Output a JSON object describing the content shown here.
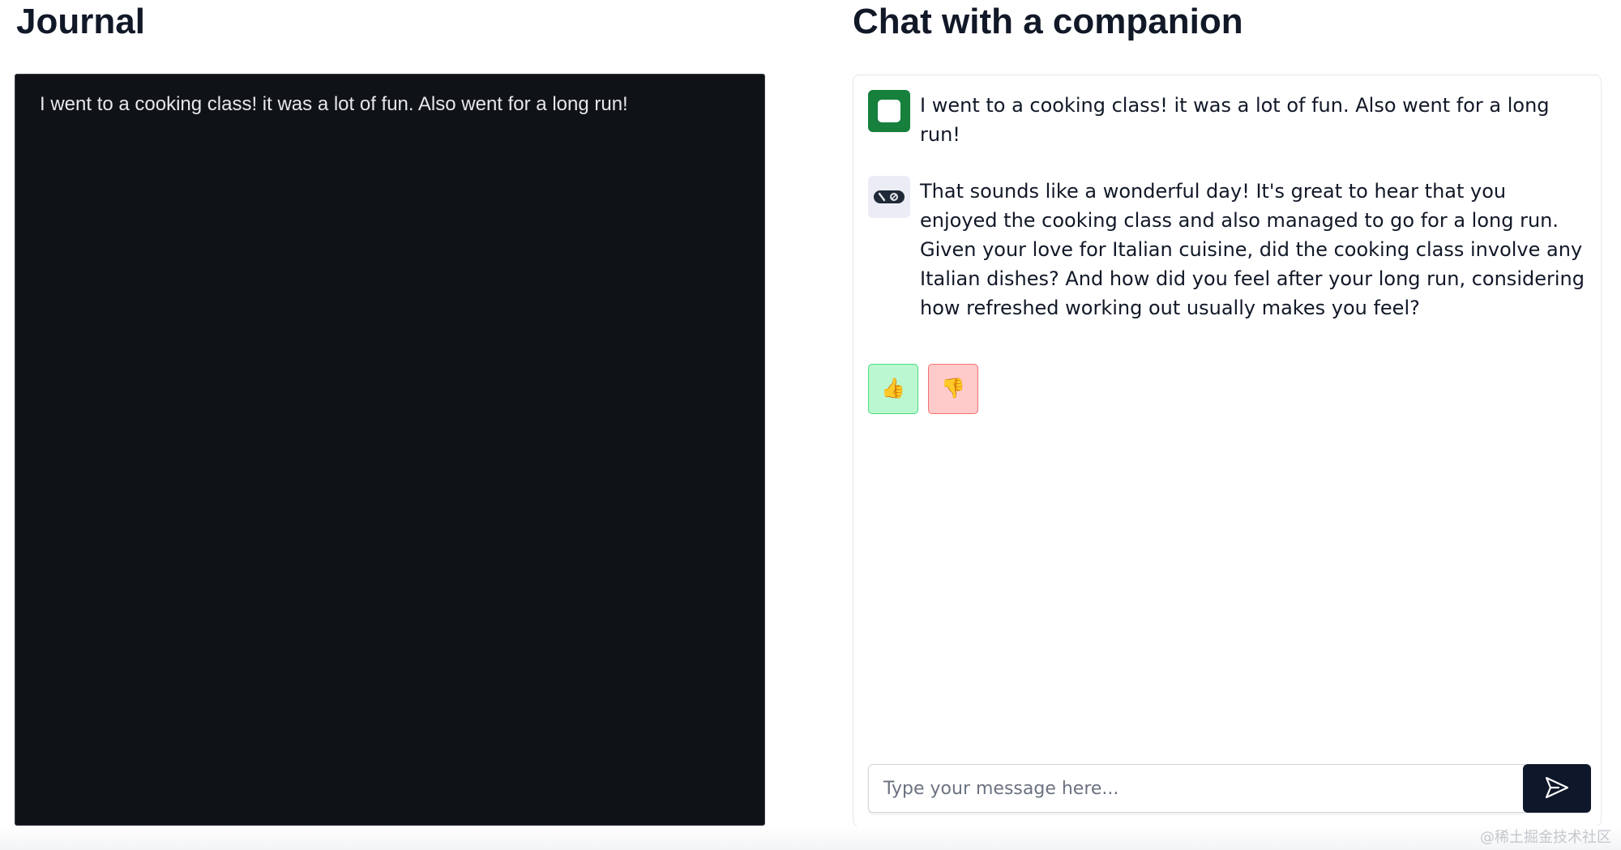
{
  "journal": {
    "title": "Journal",
    "entry_text": "I went to a cooking class! it was a lot of fun. Also went for a long run!"
  },
  "chat": {
    "title": "Chat with a companion",
    "messages": [
      {
        "role": "user",
        "avatar_icon": "user-avatar-icon",
        "text": "I went to a cooking class! it was a lot of fun. Also went for a long run!"
      },
      {
        "role": "assistant",
        "avatar_icon": "bot-avatar-icon",
        "text": "That sounds like a wonderful day! It's great to hear that you enjoyed the cooking class and also managed to go for a long run. Given your love for Italian cuisine, did the cooking class involve any Italian dishes? And how did you feel after your long run, considering how refreshed working out usually makes you feel?"
      }
    ],
    "feedback": {
      "thumbs_up_icon": "thumbs-up-icon",
      "thumbs_up_label": "👍",
      "thumbs_down_icon": "thumbs-down-icon",
      "thumbs_down_label": "👎",
      "up_color": "#bbf7d0",
      "down_color": "#fecaca"
    },
    "input": {
      "placeholder": "Type your message here...",
      "value": ""
    },
    "send_icon": "send-icon"
  },
  "watermark": "@稀土掘金技术社区",
  "colors": {
    "journal_bg": "#0f1217",
    "user_avatar": "#16803c",
    "send_button": "#0f172a"
  }
}
